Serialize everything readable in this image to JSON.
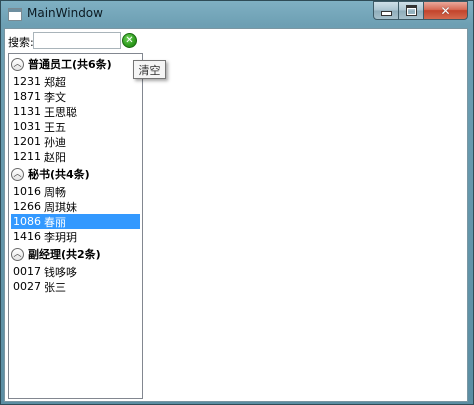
{
  "window": {
    "title": "MainWindow"
  },
  "search": {
    "label": "搜索:",
    "value": "",
    "clear_tooltip": "清空"
  },
  "groups": [
    {
      "header": "普通员工(共6条)",
      "items": [
        {
          "id": "1231",
          "name": "郑超"
        },
        {
          "id": "1871",
          "name": "李文"
        },
        {
          "id": "1131",
          "name": "王思聪"
        },
        {
          "id": "1031",
          "name": "王五"
        },
        {
          "id": "1201",
          "name": "孙迪"
        },
        {
          "id": "1211",
          "name": "赵阳"
        }
      ]
    },
    {
      "header": "秘书(共4条)",
      "items": [
        {
          "id": "1016",
          "name": "周畅"
        },
        {
          "id": "1266",
          "name": "周琪妹"
        },
        {
          "id": "1086",
          "name": "春丽",
          "selected": true
        },
        {
          "id": "1416",
          "name": "李玥玥"
        }
      ]
    },
    {
      "header": "副经理(共2条)",
      "items": [
        {
          "id": "0017",
          "name": "钱哆哆"
        },
        {
          "id": "0027",
          "name": "张三"
        }
      ]
    }
  ]
}
